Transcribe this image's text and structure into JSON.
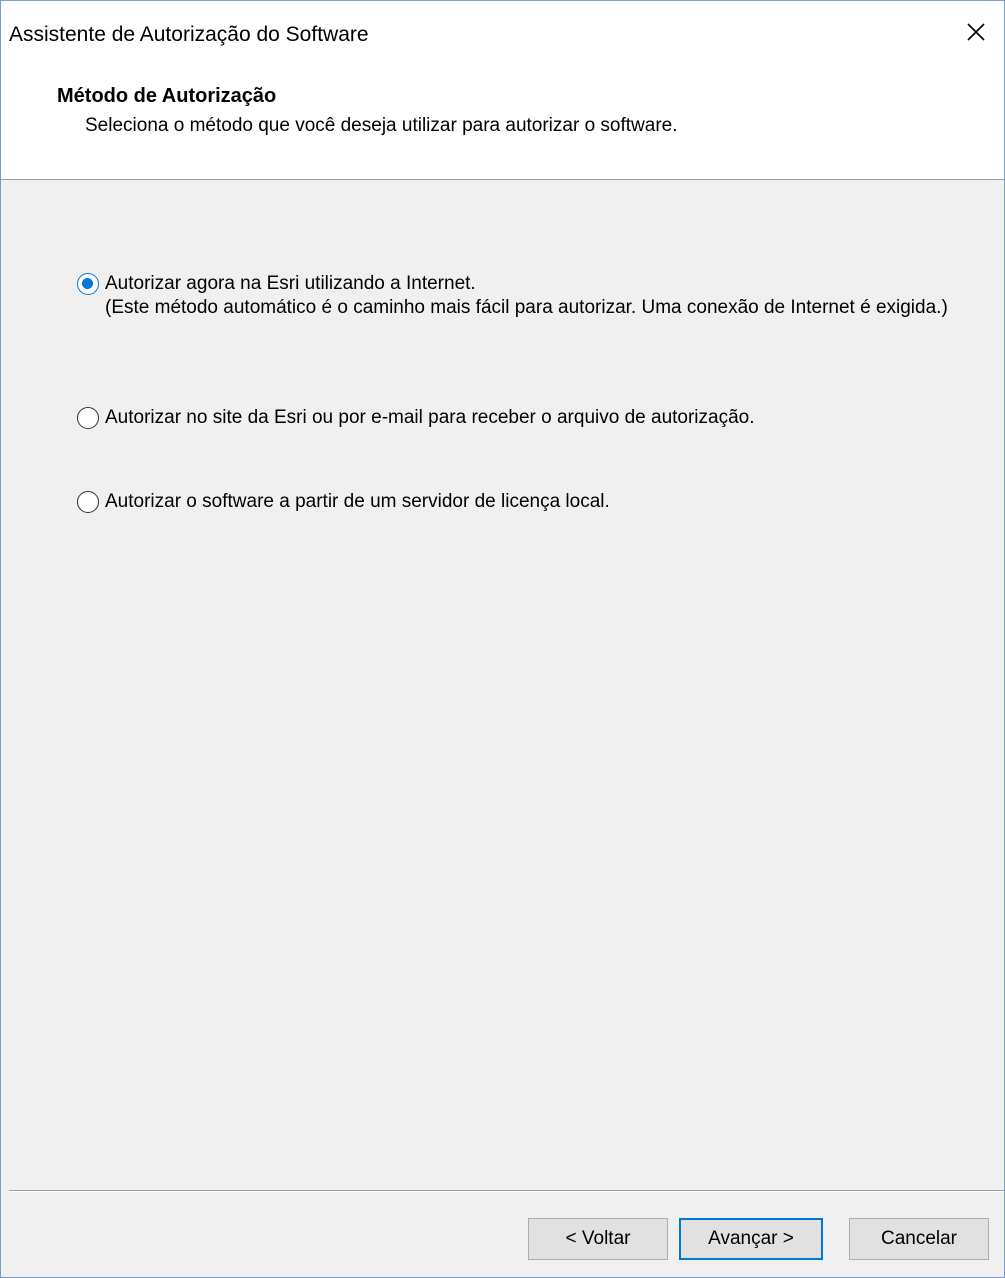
{
  "window": {
    "title": "Assistente de Autorização do Software"
  },
  "header": {
    "title": "Método de Autorização",
    "subtitle": "Seleciona o método que você deseja utilizar para autorizar o software."
  },
  "options": [
    {
      "label": "Autorizar agora na Esri utilizando a Internet.",
      "description": "(Este método automático é o caminho mais fácil para autorizar. Uma conexão de Internet é exigida.)",
      "selected": true
    },
    {
      "label": "Autorizar no site da Esri ou por e-mail para receber o arquivo de autorização.",
      "selected": false
    },
    {
      "label": "Autorizar o software a partir de um servidor de licença local.",
      "selected": false
    }
  ],
  "buttons": {
    "back": "< Voltar",
    "next": "Avançar >",
    "cancel": "Cancelar"
  },
  "colors": {
    "accent": "#0078d7",
    "dialog_background": "#f0f0f0",
    "header_background": "#ffffff"
  },
  "icons": {
    "close": "close-icon"
  }
}
